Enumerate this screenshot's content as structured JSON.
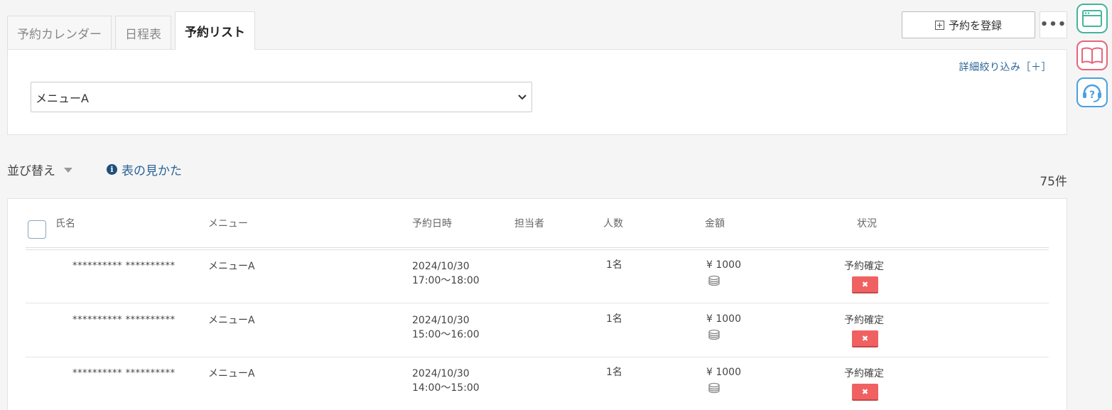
{
  "tabs": [
    {
      "label": "予約カレンダー"
    },
    {
      "label": "日程表"
    },
    {
      "label": "予約リスト"
    }
  ],
  "toolbar": {
    "register_label": "予約を登録",
    "more_label": "•••"
  },
  "filter": {
    "detail_label": "詳細絞り込み［＋］",
    "menu_value": "メニューA"
  },
  "list": {
    "sort_label": "並び替え",
    "guide_label": "表の見かた",
    "count": "75件"
  },
  "table": {
    "headers": {
      "name": "氏名",
      "menu": "メニュー",
      "datetime": "予約日時",
      "staff": "担当者",
      "people": "人数",
      "amount": "金額",
      "status": "状況"
    },
    "rows": [
      {
        "name": "********** **********",
        "menu": "メニューA",
        "date": "2024/10/30",
        "time": "17:00～18:00",
        "people": "1名",
        "amount": "¥ 1000",
        "status": "予約確定"
      },
      {
        "name": "********** **********",
        "menu": "メニューA",
        "date": "2024/10/30",
        "time": "15:00～16:00",
        "people": "1名",
        "amount": "¥ 1000",
        "status": "予約確定"
      },
      {
        "name": "********** **********",
        "menu": "メニューA",
        "date": "2024/10/30",
        "time": "14:00～15:00",
        "people": "1名",
        "amount": "¥ 1000",
        "status": "予約確定"
      }
    ]
  },
  "side_icons": [
    "calendar-window-icon",
    "book-icon",
    "help-headset-icon"
  ],
  "colors": {
    "accent_link": "#2a6496",
    "cancel_red": "#f06262",
    "calendar_green": "#46b49a",
    "book_pink": "#e8657a",
    "help_blue": "#4aa0e0"
  }
}
